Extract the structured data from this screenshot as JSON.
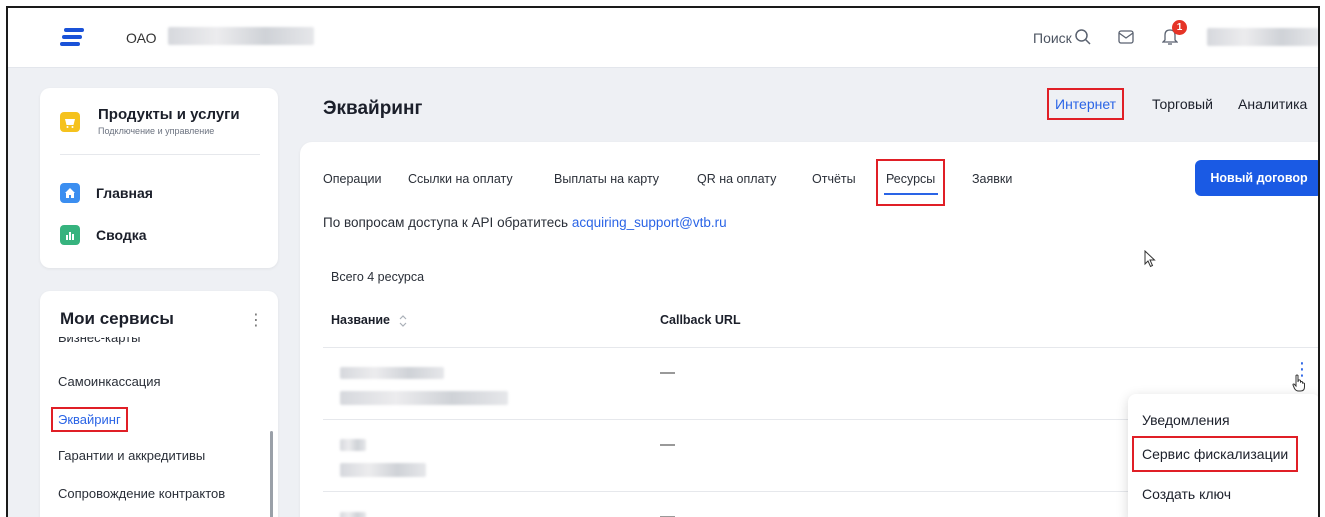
{
  "header": {
    "company_prefix": "ОАО",
    "search_label": "Поиск",
    "notification_count": "1"
  },
  "sidebar": {
    "products": {
      "title": "Продукты и услуги",
      "subtitle": "Подключение и управление"
    },
    "nav": [
      {
        "label": "Главная",
        "icon": "home-icon",
        "color": "#3b8ef0"
      },
      {
        "label": "Сводка",
        "icon": "chart-icon",
        "color": "#36b37e"
      }
    ],
    "services": {
      "title": "Мои сервисы",
      "clipped_item": "Бизнес-карты",
      "items": [
        "Самоинкассация",
        "Эквайринг",
        "Гарантии и аккредитивы",
        "Сопровождение контрактов"
      ]
    }
  },
  "main": {
    "title": "Эквайринг",
    "top_tabs": [
      "Интернет",
      "Торговый",
      "Аналитика"
    ],
    "tabs": [
      "Операции",
      "Ссылки на оплату",
      "Выплаты на карту",
      "QR на оплату",
      "Отчёты",
      "Ресурсы",
      "Заявки"
    ],
    "active_tab": "Ресурсы",
    "new_contract_button": "Новый договор",
    "api_text": "По вопросам доступа к API обратитесь",
    "api_email": "acquiring_support@vtb.ru",
    "resource_count": "Всего 4 ресурса",
    "columns": [
      "Название",
      "Callback URL"
    ],
    "rows": [
      {
        "callback": "—"
      },
      {
        "callback": "—"
      },
      {
        "callback": "—"
      }
    ]
  },
  "context_menu": {
    "items": [
      "Уведомления",
      "Сервис фискализации",
      "Создать ключ"
    ],
    "highlighted": "Сервис фискализации"
  },
  "colors": {
    "accent": "#1a5ae4",
    "highlight": "#e01f26",
    "products_icon": "#f5c21d"
  }
}
